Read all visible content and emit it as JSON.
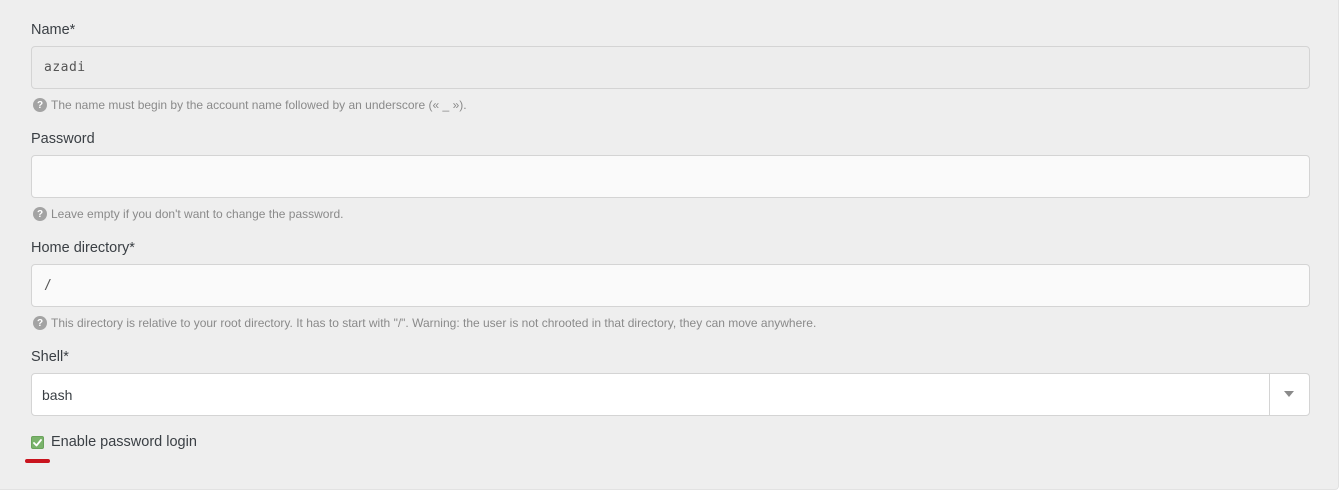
{
  "form": {
    "name": {
      "label": "Name*",
      "value": "azadi",
      "help": "The name must begin by the account name followed by an underscore (« _ »)."
    },
    "password": {
      "label": "Password",
      "value": "",
      "help": "Leave empty if you don't want to change the password."
    },
    "home": {
      "label": "Home directory*",
      "value": "/",
      "help": "This directory is relative to your root directory. It has to start with \"/\". Warning: the user is not chrooted in that directory, they can move anywhere."
    },
    "shell": {
      "label": "Shell*",
      "value": "bash"
    },
    "password_login": {
      "label": "Enable password login",
      "checked": true
    }
  },
  "icons": {
    "help": "question-circle-icon",
    "dropdown": "chevron-down-icon",
    "check": "checkmark-icon"
  },
  "colors": {
    "checkbox": "#7ab36b",
    "annotation": "#c9141e"
  }
}
